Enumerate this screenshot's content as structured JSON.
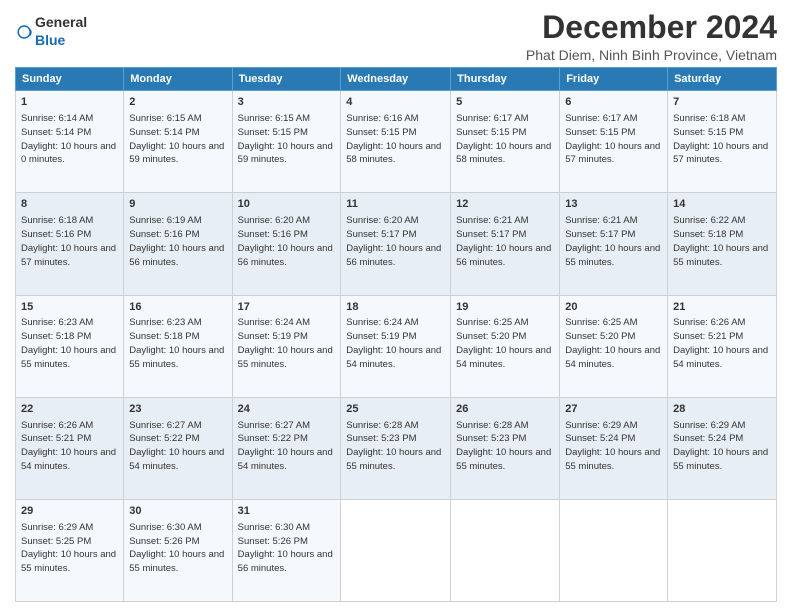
{
  "header": {
    "logo_general": "General",
    "logo_blue": "Blue",
    "title": "December 2024",
    "location": "Phat Diem, Ninh Binh Province, Vietnam"
  },
  "days_of_week": [
    "Sunday",
    "Monday",
    "Tuesday",
    "Wednesday",
    "Thursday",
    "Friday",
    "Saturday"
  ],
  "weeks": [
    [
      {
        "day": 1,
        "sunrise": "6:14 AM",
        "sunset": "5:14 PM",
        "daylight": "10 hours and 0 minutes"
      },
      {
        "day": 2,
        "sunrise": "6:15 AM",
        "sunset": "5:14 PM",
        "daylight": "10 hours and 59 minutes"
      },
      {
        "day": 3,
        "sunrise": "6:15 AM",
        "sunset": "5:15 PM",
        "daylight": "10 hours and 59 minutes"
      },
      {
        "day": 4,
        "sunrise": "6:16 AM",
        "sunset": "5:15 PM",
        "daylight": "10 hours and 58 minutes"
      },
      {
        "day": 5,
        "sunrise": "6:17 AM",
        "sunset": "5:15 PM",
        "daylight": "10 hours and 58 minutes"
      },
      {
        "day": 6,
        "sunrise": "6:17 AM",
        "sunset": "5:15 PM",
        "daylight": "10 hours and 57 minutes"
      },
      {
        "day": 7,
        "sunrise": "6:18 AM",
        "sunset": "5:15 PM",
        "daylight": "10 hours and 57 minutes"
      }
    ],
    [
      {
        "day": 8,
        "sunrise": "6:18 AM",
        "sunset": "5:16 PM",
        "daylight": "10 hours and 57 minutes"
      },
      {
        "day": 9,
        "sunrise": "6:19 AM",
        "sunset": "5:16 PM",
        "daylight": "10 hours and 56 minutes"
      },
      {
        "day": 10,
        "sunrise": "6:20 AM",
        "sunset": "5:16 PM",
        "daylight": "10 hours and 56 minutes"
      },
      {
        "day": 11,
        "sunrise": "6:20 AM",
        "sunset": "5:17 PM",
        "daylight": "10 hours and 56 minutes"
      },
      {
        "day": 12,
        "sunrise": "6:21 AM",
        "sunset": "5:17 PM",
        "daylight": "10 hours and 56 minutes"
      },
      {
        "day": 13,
        "sunrise": "6:21 AM",
        "sunset": "5:17 PM",
        "daylight": "10 hours and 55 minutes"
      },
      {
        "day": 14,
        "sunrise": "6:22 AM",
        "sunset": "5:18 PM",
        "daylight": "10 hours and 55 minutes"
      }
    ],
    [
      {
        "day": 15,
        "sunrise": "6:23 AM",
        "sunset": "5:18 PM",
        "daylight": "10 hours and 55 minutes"
      },
      {
        "day": 16,
        "sunrise": "6:23 AM",
        "sunset": "5:18 PM",
        "daylight": "10 hours and 55 minutes"
      },
      {
        "day": 17,
        "sunrise": "6:24 AM",
        "sunset": "5:19 PM",
        "daylight": "10 hours and 55 minutes"
      },
      {
        "day": 18,
        "sunrise": "6:24 AM",
        "sunset": "5:19 PM",
        "daylight": "10 hours and 54 minutes"
      },
      {
        "day": 19,
        "sunrise": "6:25 AM",
        "sunset": "5:20 PM",
        "daylight": "10 hours and 54 minutes"
      },
      {
        "day": 20,
        "sunrise": "6:25 AM",
        "sunset": "5:20 PM",
        "daylight": "10 hours and 54 minutes"
      },
      {
        "day": 21,
        "sunrise": "6:26 AM",
        "sunset": "5:21 PM",
        "daylight": "10 hours and 54 minutes"
      }
    ],
    [
      {
        "day": 22,
        "sunrise": "6:26 AM",
        "sunset": "5:21 PM",
        "daylight": "10 hours and 54 minutes"
      },
      {
        "day": 23,
        "sunrise": "6:27 AM",
        "sunset": "5:22 PM",
        "daylight": "10 hours and 54 minutes"
      },
      {
        "day": 24,
        "sunrise": "6:27 AM",
        "sunset": "5:22 PM",
        "daylight": "10 hours and 54 minutes"
      },
      {
        "day": 25,
        "sunrise": "6:28 AM",
        "sunset": "5:23 PM",
        "daylight": "10 hours and 55 minutes"
      },
      {
        "day": 26,
        "sunrise": "6:28 AM",
        "sunset": "5:23 PM",
        "daylight": "10 hours and 55 minutes"
      },
      {
        "day": 27,
        "sunrise": "6:29 AM",
        "sunset": "5:24 PM",
        "daylight": "10 hours and 55 minutes"
      },
      {
        "day": 28,
        "sunrise": "6:29 AM",
        "sunset": "5:24 PM",
        "daylight": "10 hours and 55 minutes"
      }
    ],
    [
      {
        "day": 29,
        "sunrise": "6:29 AM",
        "sunset": "5:25 PM",
        "daylight": "10 hours and 55 minutes"
      },
      {
        "day": 30,
        "sunrise": "6:30 AM",
        "sunset": "5:26 PM",
        "daylight": "10 hours and 55 minutes"
      },
      {
        "day": 31,
        "sunrise": "6:30 AM",
        "sunset": "5:26 PM",
        "daylight": "10 hours and 56 minutes"
      },
      null,
      null,
      null,
      null
    ]
  ]
}
